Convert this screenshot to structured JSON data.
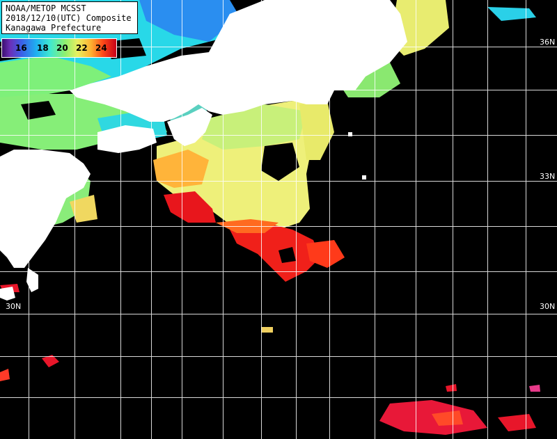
{
  "header": {
    "line1": "NOAA/METOP MCSST",
    "line2": "2018/12/10(UTC) Composite",
    "line3": "Kanagawa Prefecture"
  },
  "color_scale": {
    "labels": [
      "16",
      "18",
      "20",
      "22",
      "24"
    ],
    "colors": [
      "#3a0e6e",
      "#3b60e8",
      "#1fb0f0",
      "#8cf070",
      "#e8f060",
      "#ffb030",
      "#ff4a18",
      "#c80018"
    ]
  },
  "latitude_labels": {
    "right_36": "36N",
    "right_33": "33N",
    "left_30": "30N",
    "right_30": "30N"
  },
  "map": {
    "ocean_color": "#000000",
    "land_color": "#ffffff",
    "grid_color": "#ffffff"
  }
}
